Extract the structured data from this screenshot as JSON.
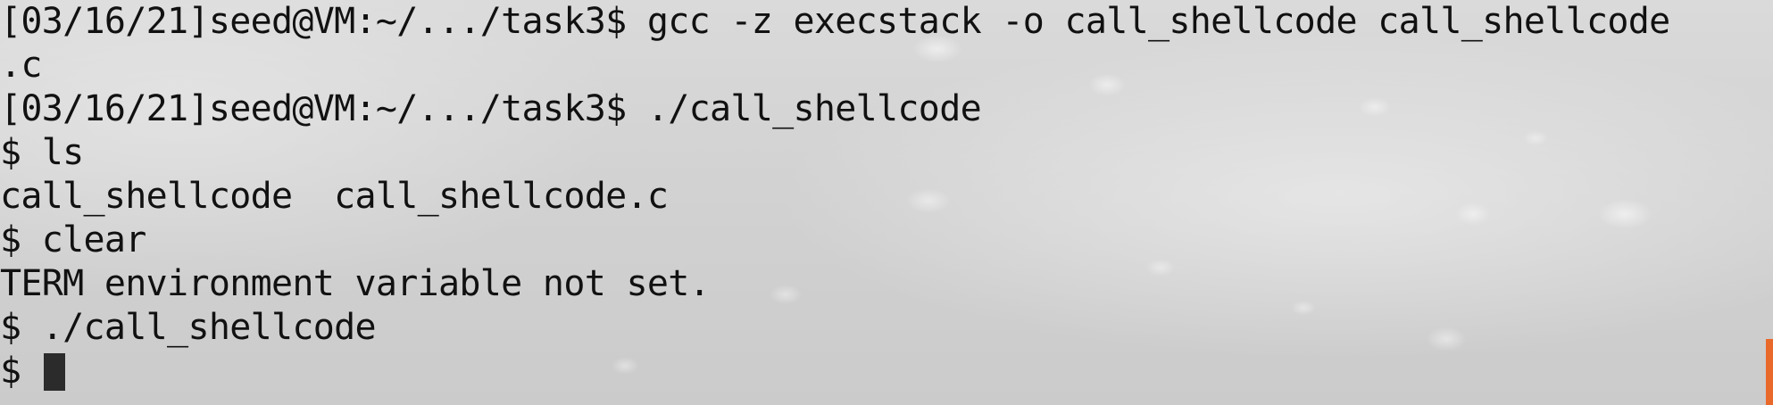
{
  "terminal": {
    "lines": [
      "[03/16/21]seed@VM:~/.../task3$ gcc -z execstack -o call_shellcode call_shellcode",
      ".c",
      "[03/16/21]seed@VM:~/.../task3$ ./call_shellcode",
      "$ ls",
      "call_shellcode  call_shellcode.c",
      "$ clear",
      "TERM environment variable not set.",
      "$ ./call_shellcode"
    ],
    "prompt": "$ "
  },
  "colors": {
    "text": "#111111",
    "cursor": "#2b2b2b",
    "accent": "#e8692a"
  }
}
